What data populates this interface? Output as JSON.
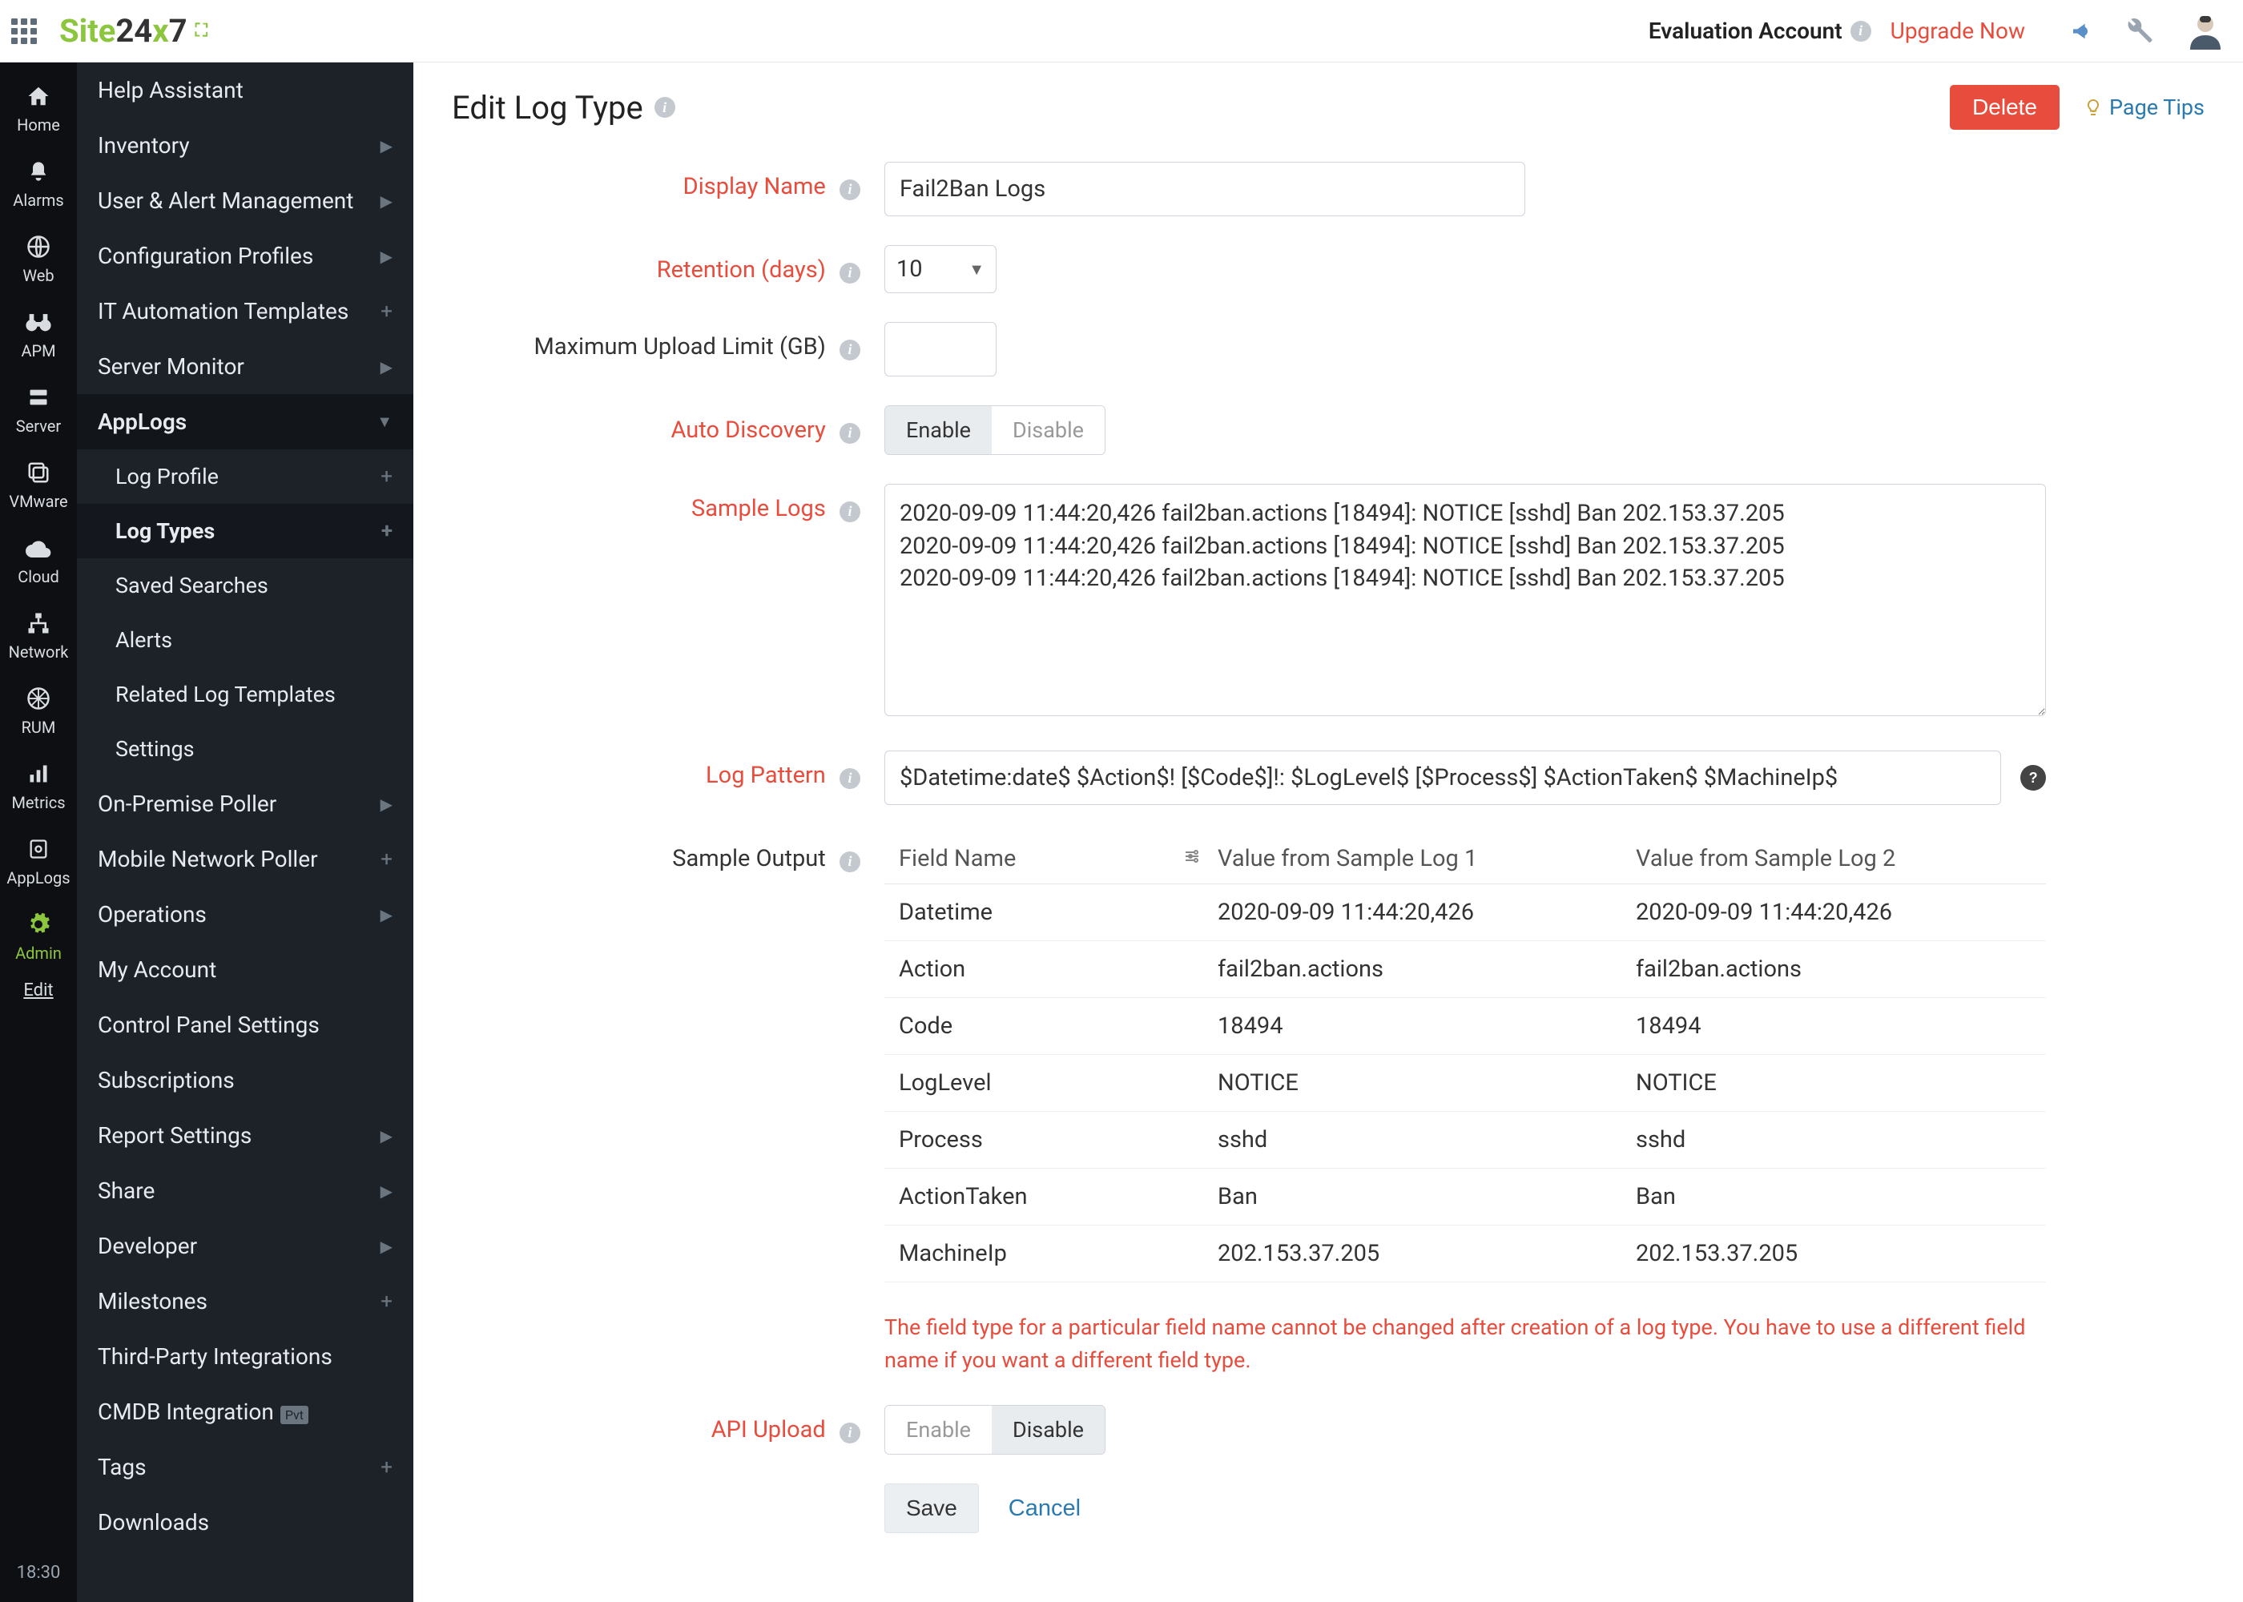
{
  "topbar": {
    "logo_site": "Site",
    "logo_24": "24",
    "logo_x": "x",
    "logo_7": "7",
    "eval": "Evaluation Account",
    "upgrade": "Upgrade Now"
  },
  "iconrail": {
    "items": [
      {
        "label": "Home"
      },
      {
        "label": "Alarms"
      },
      {
        "label": "Web"
      },
      {
        "label": "APM"
      },
      {
        "label": "Server"
      },
      {
        "label": "VMware"
      },
      {
        "label": "Cloud"
      },
      {
        "label": "Network"
      },
      {
        "label": "RUM"
      },
      {
        "label": "Metrics"
      },
      {
        "label": "AppLogs"
      },
      {
        "label": "Admin"
      }
    ],
    "edit": "Edit",
    "time": "18:30"
  },
  "sidebar": {
    "help_assistant": "Help Assistant",
    "inventory": "Inventory",
    "user_alert": "User & Alert Management",
    "config_profiles": "Configuration Profiles",
    "it_automation": "IT Automation Templates",
    "server_monitor": "Server Monitor",
    "applogs": "AppLogs",
    "log_profile": "Log Profile",
    "log_types": "Log Types",
    "saved_searches": "Saved Searches",
    "alerts": "Alerts",
    "related_templates": "Related Log Templates",
    "settings": "Settings",
    "on_premise": "On-Premise Poller",
    "mobile_network": "Mobile Network Poller",
    "operations": "Operations",
    "my_account": "My Account",
    "control_panel": "Control Panel Settings",
    "subscriptions": "Subscriptions",
    "report_settings": "Report Settings",
    "share": "Share",
    "developer": "Developer",
    "milestones": "Milestones",
    "third_party": "Third-Party Integrations",
    "cmdb": "CMDB Integration",
    "cmdb_badge": "Pvt",
    "tags": "Tags",
    "downloads": "Downloads"
  },
  "page": {
    "title": "Edit Log Type",
    "delete": "Delete",
    "page_tips": "Page Tips"
  },
  "form": {
    "display_name_label": "Display Name",
    "display_name_value": "Fail2Ban Logs",
    "retention_label": "Retention (days)",
    "retention_value": "10",
    "max_upload_label": "Maximum Upload Limit (GB)",
    "max_upload_value": "",
    "auto_discovery_label": "Auto Discovery",
    "enable": "Enable",
    "disable": "Disable",
    "sample_logs_label": "Sample Logs",
    "sample_logs_value": "2020-09-09 11:44:20,426 fail2ban.actions [18494]: NOTICE [sshd] Ban 202.153.37.205\n2020-09-09 11:44:20,426 fail2ban.actions [18494]: NOTICE [sshd] Ban 202.153.37.205\n2020-09-09 11:44:20,426 fail2ban.actions [18494]: NOTICE [sshd] Ban 202.153.37.205",
    "log_pattern_label": "Log Pattern",
    "log_pattern_value": "$Datetime:date$ $Action$! [$Code$]!: $LogLevel$ [$Process$] $ActionTaken$ $MachineIp$",
    "sample_output_label": "Sample Output",
    "warning_text": "The field type for a particular field name cannot be changed after creation of a log type. You have to use a different field name if you want a different field type.",
    "api_upload_label": "API Upload",
    "save": "Save",
    "cancel": "Cancel"
  },
  "sample_output": {
    "col1": "Field Name",
    "col2": "Value from Sample Log 1",
    "col3": "Value from Sample Log 2",
    "rows": [
      {
        "field": "Datetime",
        "v1": "2020-09-09 11:44:20,426",
        "v2": "2020-09-09 11:44:20,426"
      },
      {
        "field": "Action",
        "v1": "fail2ban.actions",
        "v2": "fail2ban.actions"
      },
      {
        "field": "Code",
        "v1": "18494",
        "v2": "18494"
      },
      {
        "field": "LogLevel",
        "v1": "NOTICE",
        "v2": "NOTICE"
      },
      {
        "field": "Process",
        "v1": "sshd",
        "v2": "sshd"
      },
      {
        "field": "ActionTaken",
        "v1": "Ban",
        "v2": "Ban"
      },
      {
        "field": "MachineIp",
        "v1": "202.153.37.205",
        "v2": "202.153.37.205"
      }
    ]
  }
}
